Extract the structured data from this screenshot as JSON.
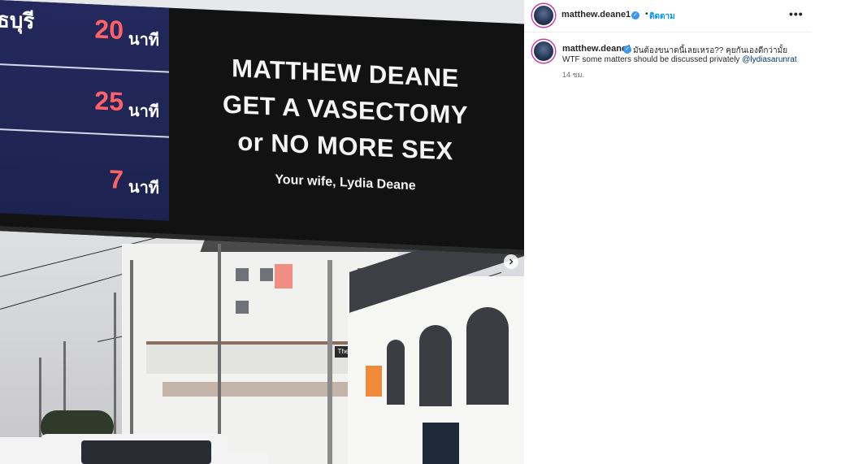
{
  "billboard": {
    "timer_rows": [
      {
        "place": "ธบุรี",
        "minutes": "20",
        "unit": "นาที"
      },
      {
        "place": "",
        "minutes": "25",
        "unit": "นาที"
      },
      {
        "place": "",
        "minutes": "7",
        "unit": "นาที"
      }
    ],
    "message_line1": "MATTHEW DEANE",
    "message_line2": "GET A VASECTOMY",
    "message_line3": "or NO MORE SEX",
    "signature": "Your wife, Lydia Deane"
  },
  "scene": {
    "shop_sign": "The Cavalry"
  },
  "post": {
    "header": {
      "username": "matthew.deane1",
      "separator": "•",
      "follow_label": "ติดตาม",
      "more_label": "•••"
    },
    "caption": {
      "username": "matthew.deane1",
      "text_thai": "มันต้องขนาดนี้เลยเหรอ?? คุยกันเองดีกว่ามั้ย",
      "text_en": "WTF some matters should be discussed privately ",
      "mention": "@lydiasarunrat",
      "time_ago": "14 ชม."
    }
  },
  "colors": {
    "follow_blue": "#0095f6",
    "verified_blue": "#3897f0",
    "mention": "#00376b",
    "timer_red": "#ff6266",
    "timer_panel": "#23295c"
  },
  "icons": {
    "verified": "verified-badge-icon",
    "next": "chevron-right-icon",
    "more": "more-options-icon"
  }
}
